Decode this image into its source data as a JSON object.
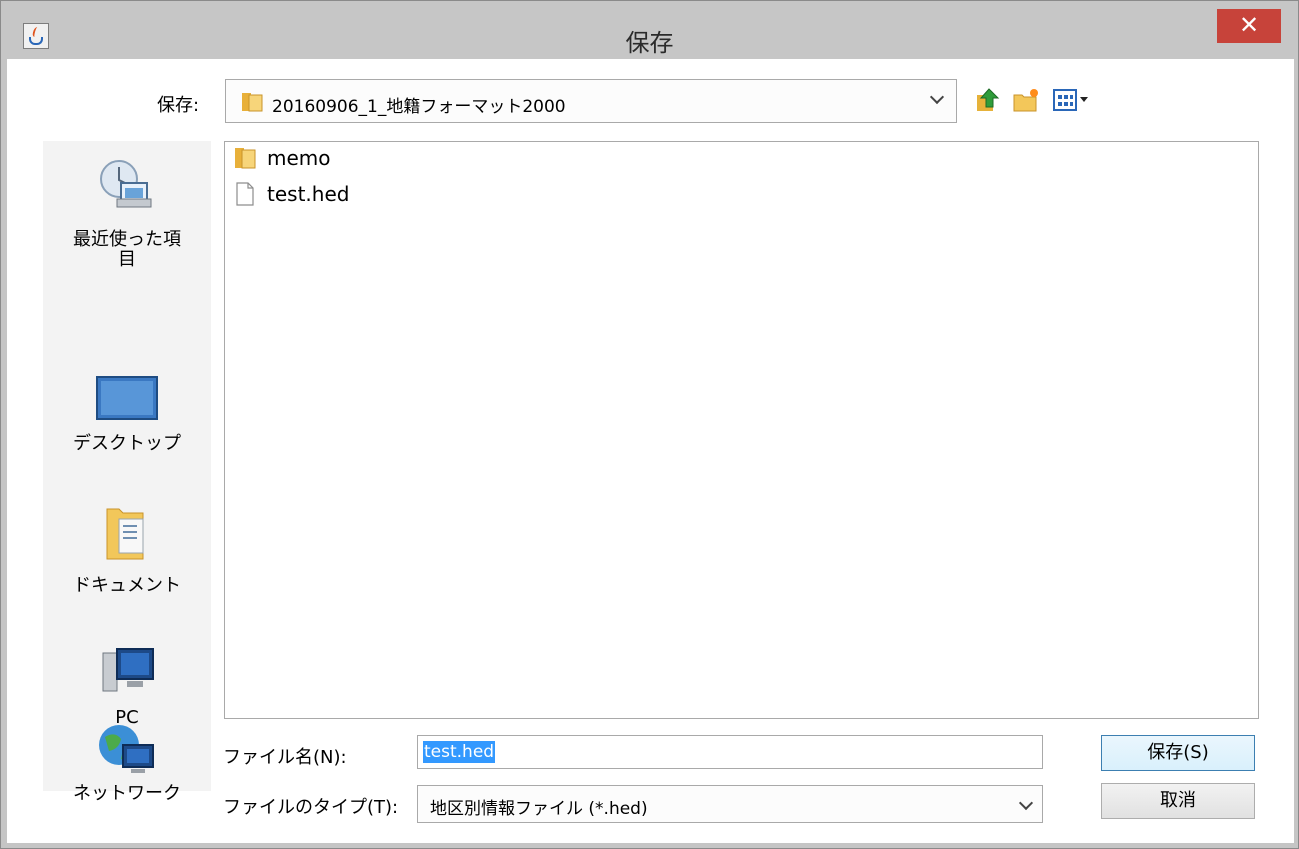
{
  "window": {
    "title": "保存",
    "close_glyph": "✕",
    "app_icon": "java-cup-icon"
  },
  "toolbar": {
    "lookin_label": "保存:",
    "lookin_value": "20160906_1_地籍フォーマット2000",
    "lookin_icon": "folder-icon",
    "buttons": [
      "up-one-level-icon",
      "new-folder-icon",
      "view-menu-icon"
    ]
  },
  "places": [
    {
      "label": "最近使った項目",
      "icon": "recent-items-icon"
    },
    {
      "label": "デスクトップ",
      "icon": "desktop-icon"
    },
    {
      "label": "ドキュメント",
      "icon": "documents-icon"
    },
    {
      "label": "PC",
      "icon": "pc-icon"
    },
    {
      "label": "ネットワーク",
      "icon": "network-icon"
    }
  ],
  "files": [
    {
      "name": "memo",
      "type": "folder"
    },
    {
      "name": "test.hed",
      "type": "file"
    }
  ],
  "filename": {
    "label": "ファイル名(N):",
    "value": "test.hed"
  },
  "filetype": {
    "label": "ファイルのタイプ(T):",
    "value": "地区別情報ファイル (*.hed)"
  },
  "actions": {
    "save": "保存(S)",
    "cancel": "取消"
  },
  "colors": {
    "titlebar": "#c6c6c6",
    "close": "#c7433a",
    "selection": "#3399ff"
  }
}
